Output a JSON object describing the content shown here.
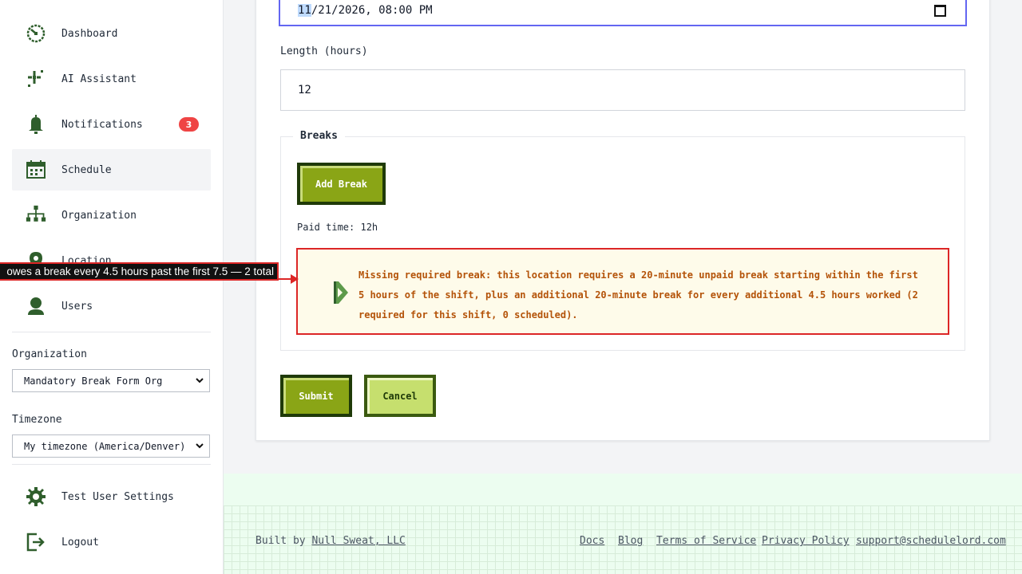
{
  "sidebar": {
    "items": [
      {
        "label": "Dashboard",
        "icon": "dashboard-icon"
      },
      {
        "label": "AI Assistant",
        "icon": "sparkle-icon"
      },
      {
        "label": "Notifications",
        "icon": "bell-icon",
        "badge": "3"
      },
      {
        "label": "Schedule",
        "icon": "calendar-icon",
        "active": true
      },
      {
        "label": "Organization",
        "icon": "org-chart-icon"
      },
      {
        "label": "Location",
        "icon": "location-pin-icon"
      },
      {
        "label": "Users",
        "icon": "user-icon"
      }
    ],
    "organization_label": "Organization",
    "organization_value": "Mandatory Break Form Org",
    "timezone_label": "Timezone",
    "timezone_value": "My timezone (America/Denver)",
    "settings_label": "Test User Settings",
    "logout_label": "Logout"
  },
  "form": {
    "datetime_value_highlight": "11",
    "datetime_value_rest": "/21/2026, 08:00 PM",
    "length_label": "Length (hours)",
    "length_value": "12",
    "breaks_legend": "Breaks",
    "add_break_label": "Add Break",
    "paid_time": "Paid time: 12h",
    "alert_message": "Missing required break: this location requires a 20-minute unpaid break starting within the first 5 hours of the shift, plus an additional 20-minute break for every additional 4.5 hours worked (2 required for this shift, 0 scheduled).",
    "submit_label": "Submit",
    "cancel_label": "Cancel"
  },
  "tooltip": {
    "text": "owes a break every 4.5 hours past the first 7.5 — 2 total"
  },
  "footer": {
    "built_by_prefix": "Built by ",
    "company": "Null Sweat, LLC",
    "links": [
      "Docs",
      "Blog",
      "Terms of Service",
      "Privacy Policy",
      "support@schedulelord.com"
    ]
  },
  "colors": {
    "brand_green": "#8aa516",
    "dark_green": "#1f3a08",
    "icon_green": "#2f5e2c",
    "alert_red": "#dc2626",
    "alert_text": "#b45309",
    "focus": "#6366f1"
  }
}
